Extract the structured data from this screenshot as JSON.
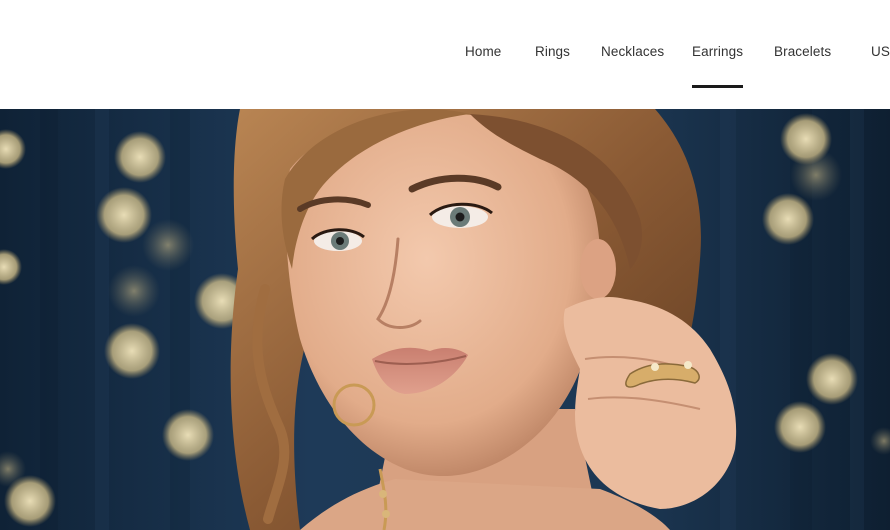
{
  "nav": {
    "items": [
      {
        "label": "Home",
        "active": false
      },
      {
        "label": "Rings",
        "active": false
      },
      {
        "label": "Necklaces",
        "active": false
      },
      {
        "label": "Earrings",
        "active": true
      },
      {
        "label": "Bracelets",
        "active": false
      },
      {
        "label": "US",
        "active": false
      }
    ]
  },
  "hero": {
    "image": "woman-wearing-gold-earrings-and-rings",
    "colors": {
      "background": "#1b3450",
      "bokeh": "#e8d9a8",
      "skin": "#e6b596",
      "hair": "#8a5a34",
      "gold": "#c99a55"
    }
  }
}
